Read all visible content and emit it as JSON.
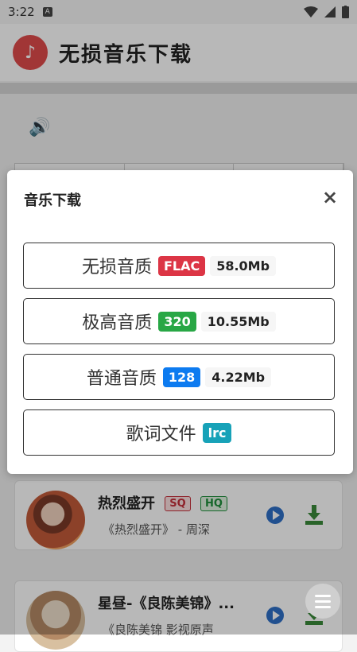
{
  "status": {
    "time": "3:22",
    "notif_icon": "A"
  },
  "app": {
    "title": "无损音乐下载",
    "logo_icon": "music-note-icon"
  },
  "songs": [
    {
      "title": "热烈盛开",
      "badge1": "SQ",
      "badge2": "HQ",
      "subtitle": "《热烈盛开》 - 周深"
    },
    {
      "title": "星昼-《良陈美锦》...",
      "subtitle": "《良陈美锦 影视原声"
    }
  ],
  "modal": {
    "title": "音乐下载",
    "close": "×",
    "options": [
      {
        "label": "无损音质",
        "tag": "FLAC",
        "size": "58.0Mb"
      },
      {
        "label": "极高音质",
        "tag": "320",
        "size": "10.55Mb"
      },
      {
        "label": "普通音质",
        "tag": "128",
        "size": "4.22Mb"
      },
      {
        "label": "歌词文件",
        "tag": "lrc"
      }
    ]
  },
  "colors": {
    "flac": "#dc3545",
    "q320": "#28a745",
    "q128": "#0d7bf0",
    "lrc": "#17a2b8",
    "logo": "#e04b4b"
  }
}
